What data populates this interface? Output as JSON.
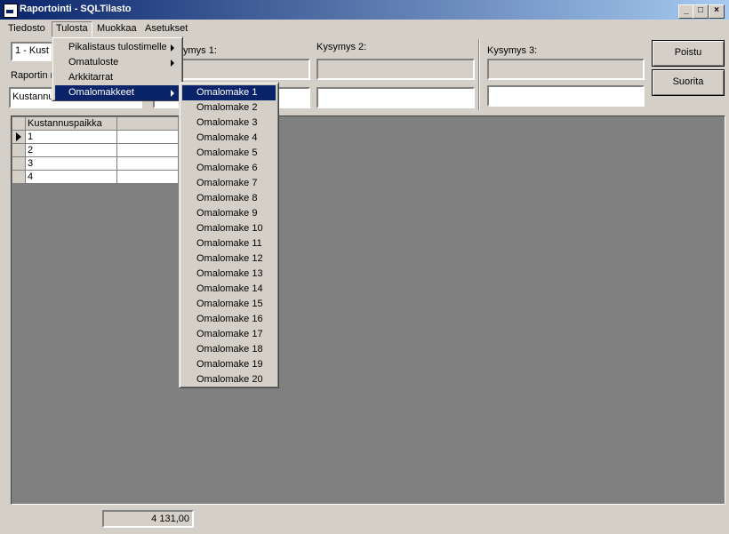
{
  "window": {
    "title": "Raportointi - SQLTilasto",
    "min": "_",
    "max": "□",
    "close": "×"
  },
  "menubar": {
    "items": [
      "Tiedosto",
      "Tulosta",
      "Muokkaa",
      "Asetukset"
    ]
  },
  "tulosta_menu": {
    "items": [
      "Pikalistaus tulostimelle",
      "Omatuloste",
      "Arkkitarrat",
      "Omalomakkeet"
    ],
    "selected": "Omalomakkeet"
  },
  "omalomakkeet_menu": {
    "items": [
      "Omalomake 1",
      "Omalomake 2",
      "Omalomake 3",
      "Omalomake 4",
      "Omalomake 5",
      "Omalomake 6",
      "Omalomake 7",
      "Omalomake 8",
      "Omalomake 9",
      "Omalomake 10",
      "Omalomake 11",
      "Omalomake 12",
      "Omalomake 13",
      "Omalomake 14",
      "Omalomake 15",
      "Omalomake 16",
      "Omalomake 17",
      "Omalomake 18",
      "Omalomake 19",
      "Omalomake 20"
    ],
    "selected": "Omalomake 1"
  },
  "form": {
    "report_select_value": "1 - Kust",
    "report_name_label": "Raportin n",
    "report_name_value": "Kustannu",
    "question1_label": "ymys 1:",
    "question2_label": "Kysymys 2:",
    "question3_label": "Kysymys 3:"
  },
  "buttons": {
    "exit": "Poistu",
    "run": "Suorita"
  },
  "grid": {
    "column": "Kustannuspaikka",
    "rows": [
      "1",
      "2",
      "3",
      "4"
    ]
  },
  "status": {
    "total": "4 131,00"
  }
}
